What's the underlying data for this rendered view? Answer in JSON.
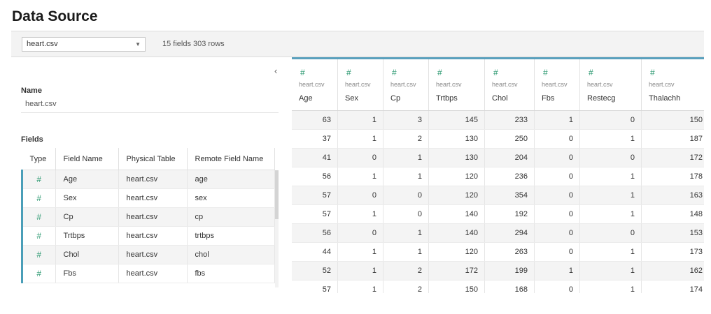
{
  "page": {
    "title": "Data Source"
  },
  "topbar": {
    "selected_source": "heart.csv",
    "summary": "15 fields 303 rows"
  },
  "left_panel": {
    "name_label": "Name",
    "name_value": "heart.csv",
    "fields_label": "Fields",
    "columns": [
      "Type",
      "Field Name",
      "Physical Table",
      "Remote Field Name"
    ],
    "rows": [
      {
        "type_icon": "#",
        "field": "Age",
        "table": "heart.csv",
        "remote": "age"
      },
      {
        "type_icon": "#",
        "field": "Sex",
        "table": "heart.csv",
        "remote": "sex"
      },
      {
        "type_icon": "#",
        "field": "Cp",
        "table": "heart.csv",
        "remote": "cp"
      },
      {
        "type_icon": "#",
        "field": "Trtbps",
        "table": "heart.csv",
        "remote": "trtbps"
      },
      {
        "type_icon": "#",
        "field": "Chol",
        "table": "heart.csv",
        "remote": "chol"
      },
      {
        "type_icon": "#",
        "field": "Fbs",
        "table": "heart.csv",
        "remote": "fbs"
      }
    ]
  },
  "grid": {
    "columns": [
      {
        "icon": "#",
        "source": "heart.csv",
        "name": "Age"
      },
      {
        "icon": "#",
        "source": "heart.csv",
        "name": "Sex"
      },
      {
        "icon": "#",
        "source": "heart.csv",
        "name": "Cp"
      },
      {
        "icon": "#",
        "source": "heart.csv",
        "name": "Trtbps"
      },
      {
        "icon": "#",
        "source": "heart.csv",
        "name": "Chol"
      },
      {
        "icon": "#",
        "source": "heart.csv",
        "name": "Fbs"
      },
      {
        "icon": "#",
        "source": "heart.csv",
        "name": "Restecg"
      },
      {
        "icon": "#",
        "source": "heart.csv",
        "name": "Thalachh"
      }
    ],
    "rows": [
      [
        "63",
        "1",
        "3",
        "145",
        "233",
        "1",
        "0",
        "150"
      ],
      [
        "37",
        "1",
        "2",
        "130",
        "250",
        "0",
        "1",
        "187"
      ],
      [
        "41",
        "0",
        "1",
        "130",
        "204",
        "0",
        "0",
        "172"
      ],
      [
        "56",
        "1",
        "1",
        "120",
        "236",
        "0",
        "1",
        "178"
      ],
      [
        "57",
        "0",
        "0",
        "120",
        "354",
        "0",
        "1",
        "163"
      ],
      [
        "57",
        "1",
        "0",
        "140",
        "192",
        "0",
        "1",
        "148"
      ],
      [
        "56",
        "0",
        "1",
        "140",
        "294",
        "0",
        "0",
        "153"
      ],
      [
        "44",
        "1",
        "1",
        "120",
        "263",
        "0",
        "1",
        "173"
      ],
      [
        "52",
        "1",
        "2",
        "172",
        "199",
        "1",
        "1",
        "162"
      ],
      [
        "57",
        "1",
        "2",
        "150",
        "168",
        "0",
        "1",
        "174"
      ]
    ]
  },
  "colors": {
    "accent": "#4a9eb8",
    "number_icon": "#2e9a72"
  },
  "icons": {
    "dropdown": "chevron-down-icon",
    "collapse": "chevron-left-icon",
    "number_type": "hash-icon"
  }
}
